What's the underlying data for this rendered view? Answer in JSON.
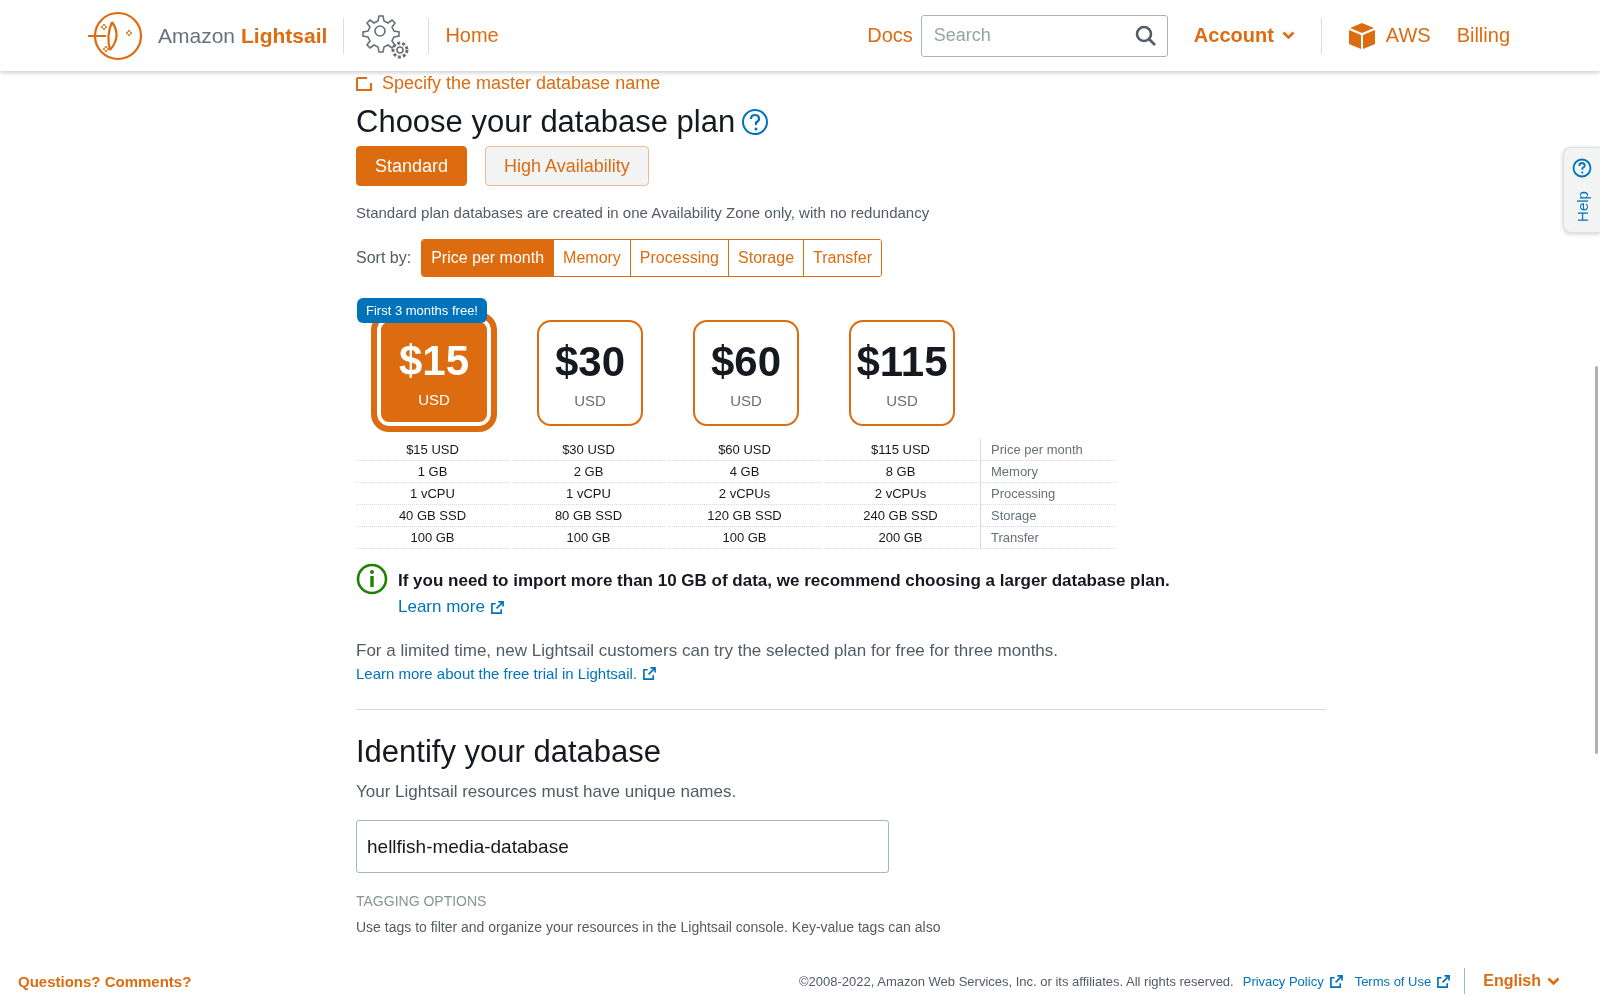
{
  "header": {
    "brand": "Amazon",
    "product": "Lightsail",
    "home": "Home",
    "docs": "Docs",
    "search": {
      "placeholder": "Search"
    },
    "account": "Account",
    "aws": "AWS",
    "billing": "Billing"
  },
  "previous_step_link": "Specify the master database name",
  "plan_section": {
    "title": "Choose your database plan",
    "plan_types": [
      {
        "label": "Standard",
        "selected": true
      },
      {
        "label": "High Availability",
        "selected": false
      }
    ],
    "description": "Standard plan databases are created in one Availability Zone only, with no redundancy",
    "sort_label": "Sort by:",
    "sort_options": [
      {
        "label": "Price per month",
        "selected": true
      },
      {
        "label": "Memory",
        "selected": false
      },
      {
        "label": "Processing",
        "selected": false
      },
      {
        "label": "Storage",
        "selected": false
      },
      {
        "label": "Transfer",
        "selected": false
      }
    ],
    "plans": [
      {
        "price": "$15",
        "currency": "USD",
        "selected": true,
        "badge": "First 3 months free!"
      },
      {
        "price": "$30",
        "currency": "USD",
        "selected": false
      },
      {
        "price": "$60",
        "currency": "USD",
        "selected": false
      },
      {
        "price": "$115",
        "currency": "USD",
        "selected": false
      }
    ],
    "spec_rows": [
      {
        "values": [
          "$15 USD",
          "$30 USD",
          "$60 USD",
          "$115 USD"
        ],
        "label": "Price per month"
      },
      {
        "values": [
          "1 GB",
          "2 GB",
          "4 GB",
          "8 GB"
        ],
        "label": "Memory"
      },
      {
        "values": [
          "1 vCPU",
          "1 vCPU",
          "2 vCPUs",
          "2 vCPUs"
        ],
        "label": "Processing"
      },
      {
        "values": [
          "40 GB SSD",
          "80 GB SSD",
          "120 GB SSD",
          "240 GB SSD"
        ],
        "label": "Storage"
      },
      {
        "values": [
          "100 GB",
          "100 GB",
          "100 GB",
          "200 GB"
        ],
        "label": "Transfer"
      }
    ],
    "info": {
      "text": "If you need to import more than 10 GB of data, we recommend choosing a larger database plan.",
      "link": "Learn more"
    },
    "free_trial": {
      "text": "For a limited time, new Lightsail customers can try the selected plan for free for three months.",
      "link": "Learn more about the free trial in Lightsail."
    }
  },
  "identify_section": {
    "title": "Identify your database",
    "subtitle": "Your Lightsail resources must have unique names.",
    "name_field": {
      "value": "hellfish-media-database"
    },
    "tagging_heading": "TAGGING OPTIONS",
    "tagging_text": "Use tags to filter and organize your resources in the Lightsail console. Key-value tags can also"
  },
  "help_tab": "Help",
  "footer": {
    "questions": "Questions? Comments?",
    "copyright": "©2008-2022, Amazon Web Services, Inc. or its affiliates. All rights reserved.",
    "links": [
      "Privacy Policy",
      "Terms of Use"
    ],
    "language": "English"
  }
}
